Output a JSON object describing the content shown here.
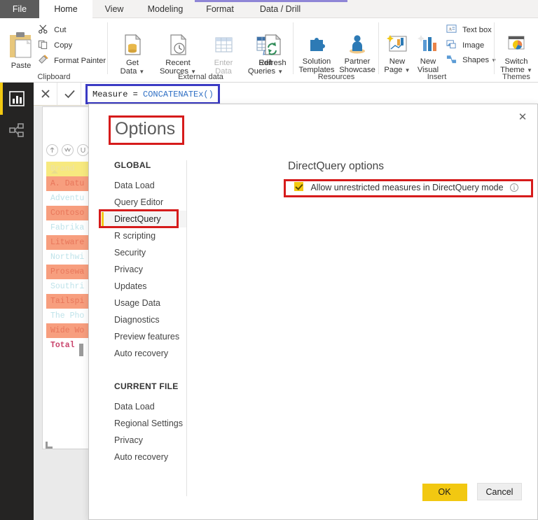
{
  "ribbon": {
    "tabs": [
      {
        "label": "File",
        "kind": "file"
      },
      {
        "label": "Home",
        "kind": "active"
      },
      {
        "label": "View",
        "kind": "normal"
      },
      {
        "label": "Modeling",
        "kind": "normal"
      },
      {
        "label": "Format",
        "kind": "contextual"
      },
      {
        "label": "Data / Drill",
        "kind": "contextual"
      }
    ],
    "groups": [
      {
        "label": "Clipboard"
      },
      {
        "label": "External data"
      },
      {
        "label": "Resources"
      },
      {
        "label": "Insert"
      },
      {
        "label": "Themes"
      }
    ],
    "clipboard": {
      "paste": "Paste",
      "cut": "Cut",
      "copy": "Copy",
      "format_painter": "Format Painter"
    },
    "external_data": {
      "get_data_line1": "Get",
      "get_data_line2": "Data",
      "recent_sources_line1": "Recent",
      "recent_sources_line2": "Sources",
      "enter_data_line1": "Enter",
      "enter_data_line2": "Data",
      "edit_queries_line1": "Edit",
      "edit_queries_line2": "Queries",
      "refresh": "Refresh"
    },
    "resources": {
      "solution_templates_line1": "Solution",
      "solution_templates_line2": "Templates",
      "partner_showcase_line1": "Partner",
      "partner_showcase_line2": "Showcase"
    },
    "insert": {
      "new_page_line1": "New",
      "new_page_line2": "Page",
      "new_visual_line1": "New",
      "new_visual_line2": "Visual",
      "text_box": "Text box",
      "image": "Image",
      "shapes": "Shapes"
    },
    "themes": {
      "switch_theme_line1": "Switch",
      "switch_theme_line2": "Theme"
    }
  },
  "rail": {
    "items": [
      {
        "name": "report-view",
        "active": true
      },
      {
        "name": "model-view",
        "active": false
      }
    ]
  },
  "formula_bar": {
    "cancel_icon": "close-icon",
    "confirm_icon": "check-icon",
    "prefix": "Measure = ",
    "function_name": "CONCATENATEx()"
  },
  "visual": {
    "column_header": "Brand",
    "rows": [
      "A. Datu",
      "Adventu",
      "Contoso",
      "Fabrika",
      "Litware",
      "Northwi",
      "Prosewa",
      "Southri",
      "Tailspi",
      "The Pho",
      "Wide Wo"
    ],
    "total_label": "Total"
  },
  "dialog": {
    "title": "Options",
    "close_label": "✕",
    "nav": {
      "global_heading": "GLOBAL",
      "global_items": [
        "Data Load",
        "Query Editor",
        "DirectQuery",
        "R scripting",
        "Security",
        "Privacy",
        "Updates",
        "Usage Data",
        "Diagnostics",
        "Preview features",
        "Auto recovery"
      ],
      "selected_global_item": "DirectQuery",
      "current_file_heading": "CURRENT FILE",
      "current_file_items": [
        "Data Load",
        "Regional Settings",
        "Privacy",
        "Auto recovery"
      ]
    },
    "pane": {
      "title": "DirectQuery options",
      "checkbox_label": "Allow unrestricted measures in DirectQuery mode",
      "checkbox_checked": true,
      "info_glyph": "i"
    },
    "buttons": {
      "ok": "OK",
      "cancel": "Cancel"
    }
  },
  "colors": {
    "brand_yellow": "#f2c811",
    "highlight_red": "#d61b1b",
    "formula_blue": "#3b3bc4",
    "contextual_purple": "#8f86d6",
    "rail_dark": "#252423"
  }
}
